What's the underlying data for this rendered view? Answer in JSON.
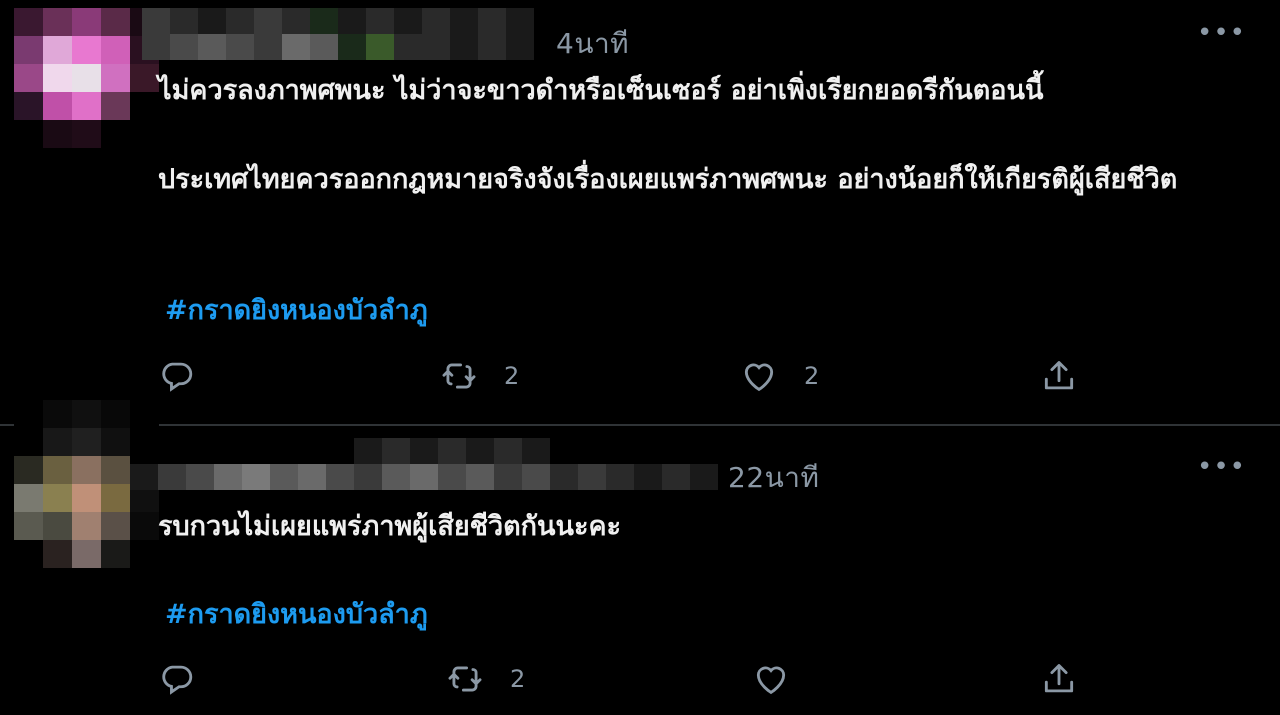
{
  "tweets": [
    {
      "time": "4นาที",
      "more": "•••",
      "text_line1": "ไม่ควรลงภาพศพนะ ไม่ว่าจะขาวดำหรือเซ็นเซอร์ อย่าเพิ่งเรียกยอดรีกันตอนนี้",
      "text_line2": "ประเทศไทยควรออกกฎหมายจริงจังเรื่องเผยแพร่ภาพศพนะ อย่างน้อยก็ให้เกียรติผู้เสียชีวิต",
      "hashtag": "#กราดยิงหนองบัวลำภู",
      "retweet_count": "2",
      "like_count": "2",
      "reply_count": "",
      "avatar_colors": [
        "#3a1830",
        "#6a3058",
        "#8a3a78",
        "#5a2a48",
        "#1a0a14",
        "#7a3a70",
        "#e0a8d8",
        "#e878d0",
        "#d060b8",
        "#2a1020",
        "#9a4888",
        "#f0d8ec",
        "#e8e0e8",
        "#d070c0",
        "#3a1828",
        "#2a1428",
        "#c050a8",
        "#e070c8",
        "#6a3858",
        "#000000",
        "#000000",
        "#1a0a14",
        "#200c18",
        "#000000",
        "#000000"
      ],
      "name_colors": [
        "#3a3a3a",
        "#2a2a2a",
        "#1a1a1a",
        "#2a2a2a",
        "#3a3a3a",
        "#2a2a2a",
        "#1a2a1a",
        "#1a1a1a",
        "#2a2a2a",
        "#1a1a1a",
        "#2a2a2a",
        "#1a1a1a",
        "#2a2a2a",
        "#1a1a1a",
        "#3a3a3a",
        "#4a4a4a",
        "#5a5a5a",
        "#4a4a4a",
        "#3a3a3a",
        "#6a6a6a",
        "#5a5a5a",
        "#1a2a1a",
        "#3a5a2a",
        "#2a2a2a",
        "#2a2a2a",
        "#1a1a1a",
        "#2a2a2a",
        "#1a1a1a"
      ]
    },
    {
      "time": "22นาที",
      "more": "•••",
      "text_line1": "รบกวนไม่เผยแพร่ภาพผู้เสียชีวิตกันนะคะ",
      "hashtag": "#กราดยิงหนองบัวลำภู",
      "retweet_count": "2",
      "like_count": "",
      "reply_count": "",
      "avatar_colors": [
        "#000000",
        "#0a0a0a",
        "#101010",
        "#080808",
        "#000000",
        "#000000",
        "#181818",
        "#202020",
        "#101010",
        "#000000",
        "#2a2a22",
        "#6a6040",
        "#8a7060",
        "#5a5040",
        "#0a0a0a",
        "#7a7a70",
        "#8a8050",
        "#c09078",
        "#7a6a40",
        "#101010",
        "#5a5a50",
        "#4a4a40",
        "#a08070",
        "#5a5048",
        "#0a0a0a",
        "#000000",
        "#2a2220",
        "#7a6a68",
        "#1a1a18",
        "#000000"
      ],
      "name_colors": [
        "#000000",
        "#000000",
        "#000000",
        "#000000",
        "#000000",
        "#000000",
        "#000000",
        "#000000",
        "#1a1a1a",
        "#2a2a2a",
        "#1a1a1a",
        "#2a2a2a",
        "#1a1a1a",
        "#2a2a2a",
        "#1a1a1a",
        "#000000",
        "#000000",
        "#000000",
        "#000000",
        "#000000",
        "#000000",
        "#1a1a1a",
        "#3a3a3a",
        "#4a4a4a",
        "#6a6a6a",
        "#7a7a7a",
        "#5a5a5a",
        "#6a6a6a",
        "#4a4a4a",
        "#3a3a3a",
        "#5a5a5a",
        "#6a6a6a",
        "#4a4a4a",
        "#5a5a5a",
        "#3a3a3a",
        "#4a4a4a",
        "#2a2a2a",
        "#3a3a3a",
        "#2a2a2a",
        "#1a1a1a",
        "#2a2a2a",
        "#1a1a1a"
      ]
    }
  ],
  "colors": {
    "background": "#000000",
    "text": "#e7e9ea",
    "secondary": "#8b98a5",
    "hashtag": "#1d9bf0",
    "divider": "#2f3336"
  },
  "icons": {
    "reply": "reply-icon",
    "retweet": "retweet-icon",
    "like": "like-icon",
    "share": "share-icon",
    "more": "more-icon"
  }
}
